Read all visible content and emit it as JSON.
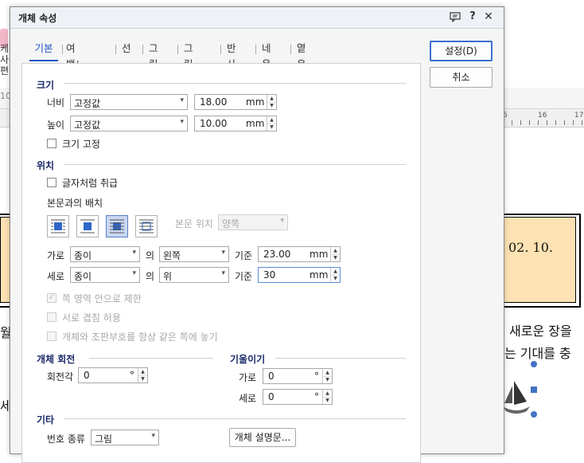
{
  "dialog": {
    "title": "개체 속성",
    "tabs": [
      "기본",
      "여백/캡션",
      "선",
      "그림",
      "그림자",
      "반사",
      "네온",
      "옅은 테두리"
    ],
    "buttons": {
      "ok": "설정(D)",
      "cancel": "취소"
    }
  },
  "size": {
    "section": "크기",
    "width_label": "너비",
    "width_mode": "고정값",
    "width_value": "18.00",
    "height_label": "높이",
    "height_mode": "고정값",
    "height_value": "10.00",
    "unit": "mm",
    "fix_size_label": "크기 고정",
    "fix_size_checked": false
  },
  "position": {
    "section": "위치",
    "treat_as_char_label": "글자처럼 취급",
    "treat_as_char_checked": false,
    "layout_label": "본문과의 배치",
    "wrap_selected_index": 2,
    "body_position_label": "본문 위치",
    "body_position_value": "양쪽",
    "horizontal_label": "가로",
    "horizontal_ref": "종이",
    "of_label_1": "의",
    "horizontal_align": "왼쪽",
    "basis_label_1": "기준",
    "horizontal_value": "23.00",
    "vertical_label": "세로",
    "vertical_ref": "종이",
    "of_label_2": "의",
    "vertical_align": "위",
    "basis_label_2": "기준",
    "vertical_value": "30",
    "unit": "mm",
    "restrict_label": "쪽 영역 안으로 제한",
    "overlap_label": "서로 겹침 허용",
    "same_page_label": "개체와 조판부호를 항상 같은 쪽에 놓기"
  },
  "rotation": {
    "section": "개체 회전",
    "angle_label": "회전각",
    "angle_value": "0",
    "degree": "°"
  },
  "skew": {
    "section": "기울이기",
    "h_label": "가로",
    "h_value": "0",
    "v_label": "세로",
    "v_value": "0",
    "degree": "°"
  },
  "etc": {
    "section": "기타",
    "number_type_label": "번호 종류",
    "number_type_value": "그림",
    "description_button": "개체 설명문..."
  },
  "background_doc": {
    "box_text": "02. 10.",
    "line1": "새로운 장을",
    "line2": "는 기대를 충",
    "left_fragments": [
      "월",
      "세"
    ],
    "ruler_numbers": [
      "5",
      "16",
      "17"
    ]
  }
}
